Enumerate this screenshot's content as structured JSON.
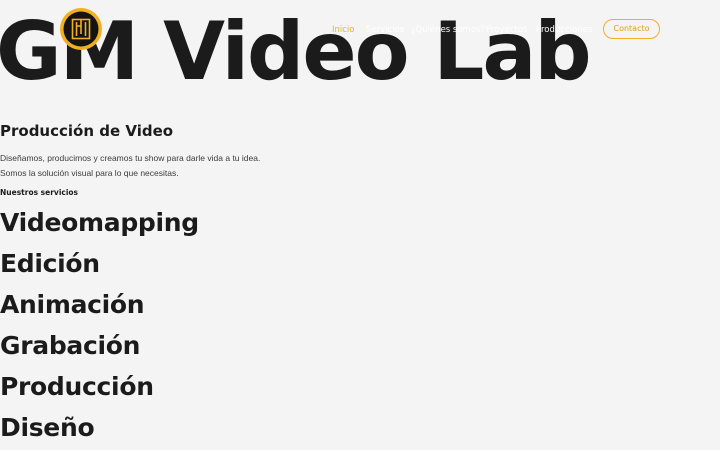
{
  "hero": {
    "title": "GM Video Lab"
  },
  "nav": {
    "items": [
      {
        "label": "Inicio",
        "active": true
      },
      {
        "label": "Servicios",
        "active": false
      },
      {
        "label": "¿Quiénes somos?",
        "active": false
      },
      {
        "label": "Proyectos",
        "active": false
      },
      {
        "label": "Producciones",
        "active": false
      }
    ],
    "contact_label": "Contacto"
  },
  "intro": {
    "heading": "Producción de Video",
    "line_1": "Diseñamos, producimos y creamos tu show para darle vida a tu idea.",
    "line_2": "Somos la solución visual para lo que necesitas."
  },
  "services": {
    "label": "Nuestros servicios",
    "items": [
      "Videomapping",
      "Edición",
      "Animación",
      "Grabación",
      "Producción",
      "Diseño"
    ]
  },
  "colors": {
    "accent": "#f2b01e",
    "text": "#1b1b1b",
    "background": "#f4f4f4"
  },
  "icons": {
    "logo": "gm-logo-icon"
  }
}
